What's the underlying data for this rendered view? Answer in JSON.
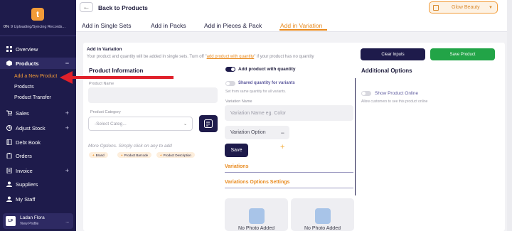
{
  "sidebar": {
    "logo": "t",
    "upload_pct": "0%",
    "upload_text": "9 Uploading/Syncing Records...",
    "items": [
      {
        "label": "Overview"
      },
      {
        "label": "Products",
        "toggle": "−"
      },
      {
        "label": "Sales",
        "toggle": "+"
      },
      {
        "label": "Adjust Stock",
        "toggle": "+"
      },
      {
        "label": "Debt Book"
      },
      {
        "label": "Orders"
      },
      {
        "label": "Invoice",
        "toggle": "+"
      },
      {
        "label": "Suppliers"
      },
      {
        "label": "My Staff"
      }
    ],
    "subitems": [
      {
        "label": "Add a New Product"
      },
      {
        "label": "Products"
      },
      {
        "label": "Product Transfer"
      }
    ],
    "profile": {
      "initials": "LF",
      "name": "Ladan Flora",
      "link": "View Profile"
    }
  },
  "header": {
    "back_label": "Back to Products",
    "store": "Glow Beauty"
  },
  "tabs": [
    {
      "label": "Add in Single Sets"
    },
    {
      "label": "Add in Packs"
    },
    {
      "label": "Add in Pieces & Pack"
    },
    {
      "label": "Add in Variation",
      "active": true
    }
  ],
  "form": {
    "title": "Add in Variation",
    "desc_pre": "Your product and quantity will be added in single sets. Turn off \"",
    "desc_link": "add product with quantity",
    "desc_post": "\" if your product has no quantity",
    "clear_btn": "Clear Inputs",
    "save_btn": "Save Product",
    "product_info": {
      "heading": "Product Information",
      "name_label": "Product Name",
      "category_label": "Product Category",
      "category_placeholder": "-Select Categ...",
      "more_options": "More Options. Simply click on any to add",
      "chips": [
        "Brand",
        "Product Barcode",
        "Product Description"
      ]
    },
    "variation": {
      "add_with_qty": "Add product with quantity",
      "shared_qty": "Shared quantity for variants",
      "shared_qty_desc": "Set from same quantity for all variants.",
      "var_name_label": "Variation Name",
      "var_name_placeholder": "Variation Name eg. Color",
      "var_option": "Variation Option",
      "save": "Save",
      "variations_heading": "Variations",
      "options_settings_heading": "Variations Options Settings",
      "photo_caption": "No Photo Added"
    },
    "additional": {
      "heading": "Additional Options",
      "show_online": "Show Product Online",
      "show_online_desc": "Allow customers to see this product online"
    }
  },
  "colors": {
    "sidebar_bg": "#1e1b4b",
    "accent": "#e8891c",
    "save_green": "#22a447",
    "annotation_red": "#e0202a"
  }
}
